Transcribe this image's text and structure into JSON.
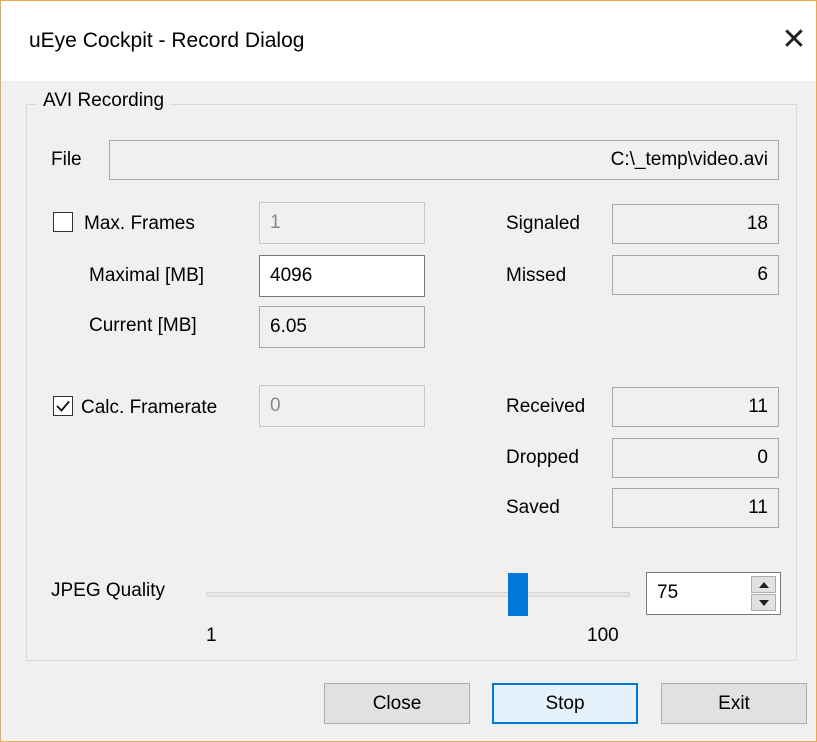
{
  "window": {
    "title": "uEye Cockpit - Record Dialog"
  },
  "group": {
    "label": "AVI Recording"
  },
  "file": {
    "label": "File",
    "value": "C:\\_temp\\video.avi"
  },
  "max_frames": {
    "label": "Max. Frames",
    "checked": false,
    "value": "1"
  },
  "maximal_mb": {
    "label": "Maximal [MB]",
    "value": "4096"
  },
  "current_mb": {
    "label": "Current [MB]",
    "value": "6.05"
  },
  "calc_framerate": {
    "label": "Calc. Framerate",
    "checked": true,
    "value": "0"
  },
  "stats": {
    "signaled": {
      "label": "Signaled",
      "value": "18"
    },
    "missed": {
      "label": "Missed",
      "value": "6"
    },
    "received": {
      "label": "Received",
      "value": "11"
    },
    "dropped": {
      "label": "Dropped",
      "value": "0"
    },
    "saved": {
      "label": "Saved",
      "value": "11"
    }
  },
  "jpeg_quality": {
    "label": "JPEG Quality",
    "min_label": "1",
    "max_label": "100",
    "value": "75",
    "level": 75,
    "min": 1,
    "max": 100
  },
  "buttons": {
    "close": "Close",
    "stop": "Stop",
    "exit": "Exit"
  },
  "colors": {
    "accent": "#0078d7",
    "window_border": "#f0a64a"
  }
}
